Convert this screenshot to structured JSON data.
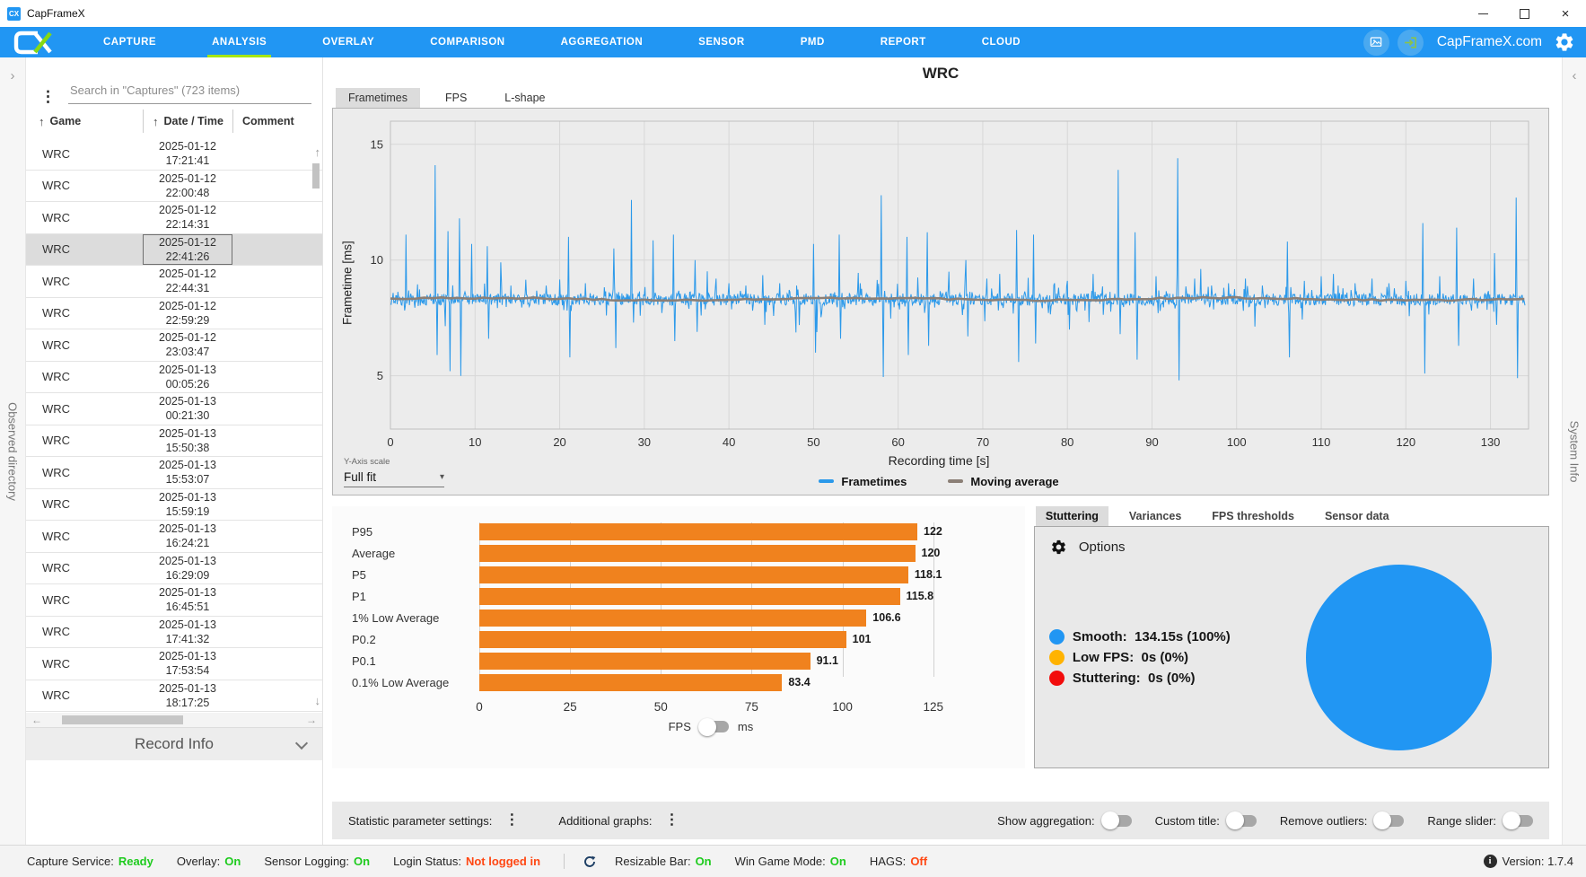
{
  "window": {
    "title": "CapFrameX"
  },
  "navbar": {
    "tabs": [
      "CAPTURE",
      "ANALYSIS",
      "OVERLAY",
      "COMPARISON",
      "AGGREGATION",
      "SENSOR",
      "PMD",
      "REPORT",
      "CLOUD"
    ],
    "active_tab": "ANALYSIS",
    "site_link": "CapFrameX.com"
  },
  "strips": {
    "observed_directory": "Observed directory",
    "system_info": "System Info"
  },
  "sidebar": {
    "search_placeholder": "Search in \"Captures\" (723 items)",
    "columns": [
      "Game",
      "Date / Time",
      "Comment"
    ],
    "selected_index": 3,
    "rows": [
      {
        "game": "WRC",
        "date": "2025-01-12",
        "time": "17:21:41"
      },
      {
        "game": "WRC",
        "date": "2025-01-12",
        "time": "22:00:48"
      },
      {
        "game": "WRC",
        "date": "2025-01-12",
        "time": "22:14:31"
      },
      {
        "game": "WRC",
        "date": "2025-01-12",
        "time": "22:41:26"
      },
      {
        "game": "WRC",
        "date": "2025-01-12",
        "time": "22:44:31"
      },
      {
        "game": "WRC",
        "date": "2025-01-12",
        "time": "22:59:29"
      },
      {
        "game": "WRC",
        "date": "2025-01-12",
        "time": "23:03:47"
      },
      {
        "game": "WRC",
        "date": "2025-01-13",
        "time": "00:05:26"
      },
      {
        "game": "WRC",
        "date": "2025-01-13",
        "time": "00:21:30"
      },
      {
        "game": "WRC",
        "date": "2025-01-13",
        "time": "15:50:38"
      },
      {
        "game": "WRC",
        "date": "2025-01-13",
        "time": "15:53:07"
      },
      {
        "game": "WRC",
        "date": "2025-01-13",
        "time": "15:59:19"
      },
      {
        "game": "WRC",
        "date": "2025-01-13",
        "time": "16:24:21"
      },
      {
        "game": "WRC",
        "date": "2025-01-13",
        "time": "16:29:09"
      },
      {
        "game": "WRC",
        "date": "2025-01-13",
        "time": "16:45:51"
      },
      {
        "game": "WRC",
        "date": "2025-01-13",
        "time": "17:41:32"
      },
      {
        "game": "WRC",
        "date": "2025-01-13",
        "time": "17:53:54"
      },
      {
        "game": "WRC",
        "date": "2025-01-13",
        "time": "18:17:25"
      }
    ],
    "record_info_label": "Record Info"
  },
  "main": {
    "title": "WRC",
    "chart_tabs": [
      "Frametimes",
      "FPS",
      "L-shape"
    ],
    "active_chart_tab": "Frametimes",
    "y_axis_scale_label": "Y-Axis scale",
    "y_axis_scale_value": "Full fit",
    "analysis_tabs": [
      "Stuttering",
      "Variances",
      "FPS thresholds",
      "Sensor data"
    ],
    "active_analysis_tab": "Stuttering",
    "options_label": "Options",
    "unit_toggle": {
      "left": "FPS",
      "right": "ms",
      "selected": "FPS"
    },
    "controls": {
      "statistic_label": "Statistic parameter settings:",
      "graphs_label": "Additional graphs:",
      "toggles": [
        {
          "label": "Show aggregation:",
          "on": false
        },
        {
          "label": "Custom title:",
          "on": false
        },
        {
          "label": "Remove outliers:",
          "on": false
        },
        {
          "label": "Range slider:",
          "on": false
        }
      ]
    }
  },
  "statusbar": {
    "left": [
      {
        "label": "Capture Service:",
        "value": "Ready",
        "color": "#1ecb1e"
      },
      {
        "label": "Overlay:",
        "value": "On",
        "color": "#1ecb1e"
      },
      {
        "label": "Sensor Logging:",
        "value": "On",
        "color": "#1ecb1e"
      },
      {
        "label": "Login Status:",
        "value": "Not logged in",
        "color": "#ff4713"
      }
    ],
    "right": [
      {
        "label": "Resizable Bar:",
        "value": "On",
        "color": "#1ecb1e"
      },
      {
        "label": "Win Game Mode:",
        "value": "On",
        "color": "#1ecb1e"
      },
      {
        "label": "HAGS:",
        "value": "Off",
        "color": "#ff4713"
      }
    ],
    "version_label": "Version: 1.7.4"
  },
  "colors": {
    "accent_blue": "#2196f3",
    "active_tab_underline": "#a4e614",
    "bar_orange": "#f0821e",
    "frametimes_blue": "#2b99ea",
    "moving_average_gray": "#8b7f76",
    "status_green": "#1ecb1e",
    "status_red": "#ff4713"
  },
  "chart_data": [
    {
      "id": "frametimes",
      "type": "line",
      "title": "WRC",
      "xlabel": "Recording time [s]",
      "ylabel": "Frametime [ms]",
      "xlim": [
        0,
        134.5
      ],
      "ylim": [
        2.7,
        16.0
      ],
      "xticks": [
        0,
        10,
        20,
        30,
        40,
        50,
        60,
        70,
        80,
        90,
        100,
        110,
        120,
        130
      ],
      "yticks": [
        5,
        10,
        15
      ],
      "grid": true,
      "legend_position": "bottom",
      "series": [
        {
          "name": "Frametimes",
          "color": "#2b99ea",
          "baseline_ms": 8.3,
          "noise_ms": 0.26,
          "duration_s": 134.15,
          "spikes": [
            [
              1.8,
              11.1
            ],
            [
              3.2,
              8.95
            ],
            [
              5.3,
              14.1
            ],
            [
              5.5,
              5.9
            ],
            [
              6.8,
              11.25
            ],
            [
              7.0,
              5.2
            ],
            [
              8.2,
              11.8
            ],
            [
              8.35,
              5.0
            ],
            [
              9.6,
              10.7
            ],
            [
              11.4,
              10.6
            ],
            [
              11.6,
              6.6
            ],
            [
              13.0,
              9.9
            ],
            [
              14.2,
              8.9
            ],
            [
              16.0,
              9.15
            ],
            [
              18.4,
              8.9
            ],
            [
              21.0,
              11.0
            ],
            [
              21.2,
              5.8
            ],
            [
              23.0,
              9.0
            ],
            [
              26.4,
              10.5
            ],
            [
              26.6,
              6.2
            ],
            [
              28.5,
              12.6
            ],
            [
              28.7,
              7.3
            ],
            [
              31.0,
              10.85
            ],
            [
              33.4,
              11.1
            ],
            [
              33.6,
              6.5
            ],
            [
              36.0,
              10.0
            ],
            [
              36.2,
              6.9
            ],
            [
              38.5,
              9.2
            ],
            [
              40.0,
              9.0
            ],
            [
              42.0,
              8.9
            ],
            [
              44.0,
              9.35
            ],
            [
              44.2,
              7.2
            ],
            [
              46.0,
              9.0
            ],
            [
              48.0,
              8.9
            ],
            [
              50.0,
              10.7
            ],
            [
              50.2,
              6.0
            ],
            [
              53.0,
              11.1
            ],
            [
              53.2,
              6.6
            ],
            [
              55.5,
              9.0
            ],
            [
              58.0,
              12.8
            ],
            [
              58.2,
              4.95
            ],
            [
              61.0,
              11.0
            ],
            [
              61.2,
              5.9
            ],
            [
              63.4,
              11.2
            ],
            [
              63.6,
              6.3
            ],
            [
              66.0,
              9.5
            ],
            [
              68.0,
              10.0
            ],
            [
              68.2,
              6.7
            ],
            [
              70.5,
              9.2
            ],
            [
              72.0,
              9.4
            ],
            [
              74.0,
              11.3
            ],
            [
              74.2,
              5.6
            ],
            [
              76.0,
              11.1
            ],
            [
              76.2,
              6.4
            ],
            [
              78.5,
              9.0
            ],
            [
              80.0,
              9.1
            ],
            [
              80.2,
              7.0
            ],
            [
              83.0,
              9.4
            ],
            [
              86.0,
              13.9
            ],
            [
              86.2,
              6.8
            ],
            [
              88.0,
              11.2
            ],
            [
              88.2,
              5.7
            ],
            [
              90.5,
              9.3
            ],
            [
              93.0,
              14.4
            ],
            [
              93.2,
              4.8
            ],
            [
              95.0,
              9.2
            ],
            [
              97.0,
              8.9
            ],
            [
              99.0,
              9.0
            ],
            [
              101.0,
              9.2
            ],
            [
              103.0,
              8.9
            ],
            [
              106.0,
              10.8
            ],
            [
              106.2,
              5.8
            ],
            [
              108.0,
              9.1
            ],
            [
              110.0,
              9.3
            ],
            [
              112.0,
              8.9
            ],
            [
              114.0,
              9.0
            ],
            [
              116.0,
              9.2
            ],
            [
              118.0,
              9.0
            ],
            [
              120.0,
              9.1
            ],
            [
              122.0,
              11.6
            ],
            [
              122.2,
              5.1
            ],
            [
              124.0,
              9.3
            ],
            [
              126.0,
              11.4
            ],
            [
              126.2,
              6.3
            ],
            [
              128.0,
              9.2
            ],
            [
              130.5,
              10.3
            ],
            [
              130.7,
              7.2
            ],
            [
              133.0,
              12.7
            ],
            [
              133.2,
              4.9
            ]
          ]
        },
        {
          "name": "Moving average",
          "color": "#8b7f76",
          "baseline_ms": 8.32
        }
      ]
    },
    {
      "id": "fps_percentiles",
      "type": "bar",
      "categories": [
        "P95",
        "Average",
        "P5",
        "P1",
        "1% Low Average",
        "P0.2",
        "P0.1",
        "0.1% Low Average"
      ],
      "values": [
        122,
        120,
        118.1,
        115.8,
        106.6,
        101,
        91.1,
        83.4
      ],
      "bar_color": "#f0821e",
      "xticks": [
        0,
        25,
        50,
        75,
        100,
        125
      ],
      "xlim": [
        0,
        127.5
      ],
      "unit": "FPS"
    },
    {
      "id": "stuttering_pie",
      "type": "pie",
      "slices": [
        {
          "label": "Smooth",
          "value_label": "134.15s (100%)",
          "value": 100,
          "color": "#2196f3"
        },
        {
          "label": "Low FPS",
          "value_label": "0s (0%)",
          "value": 0,
          "color": "#ffb300"
        },
        {
          "label": "Stuttering",
          "value_label": "0s (0%)",
          "value": 0,
          "color": "#f20c0c"
        }
      ]
    }
  ]
}
